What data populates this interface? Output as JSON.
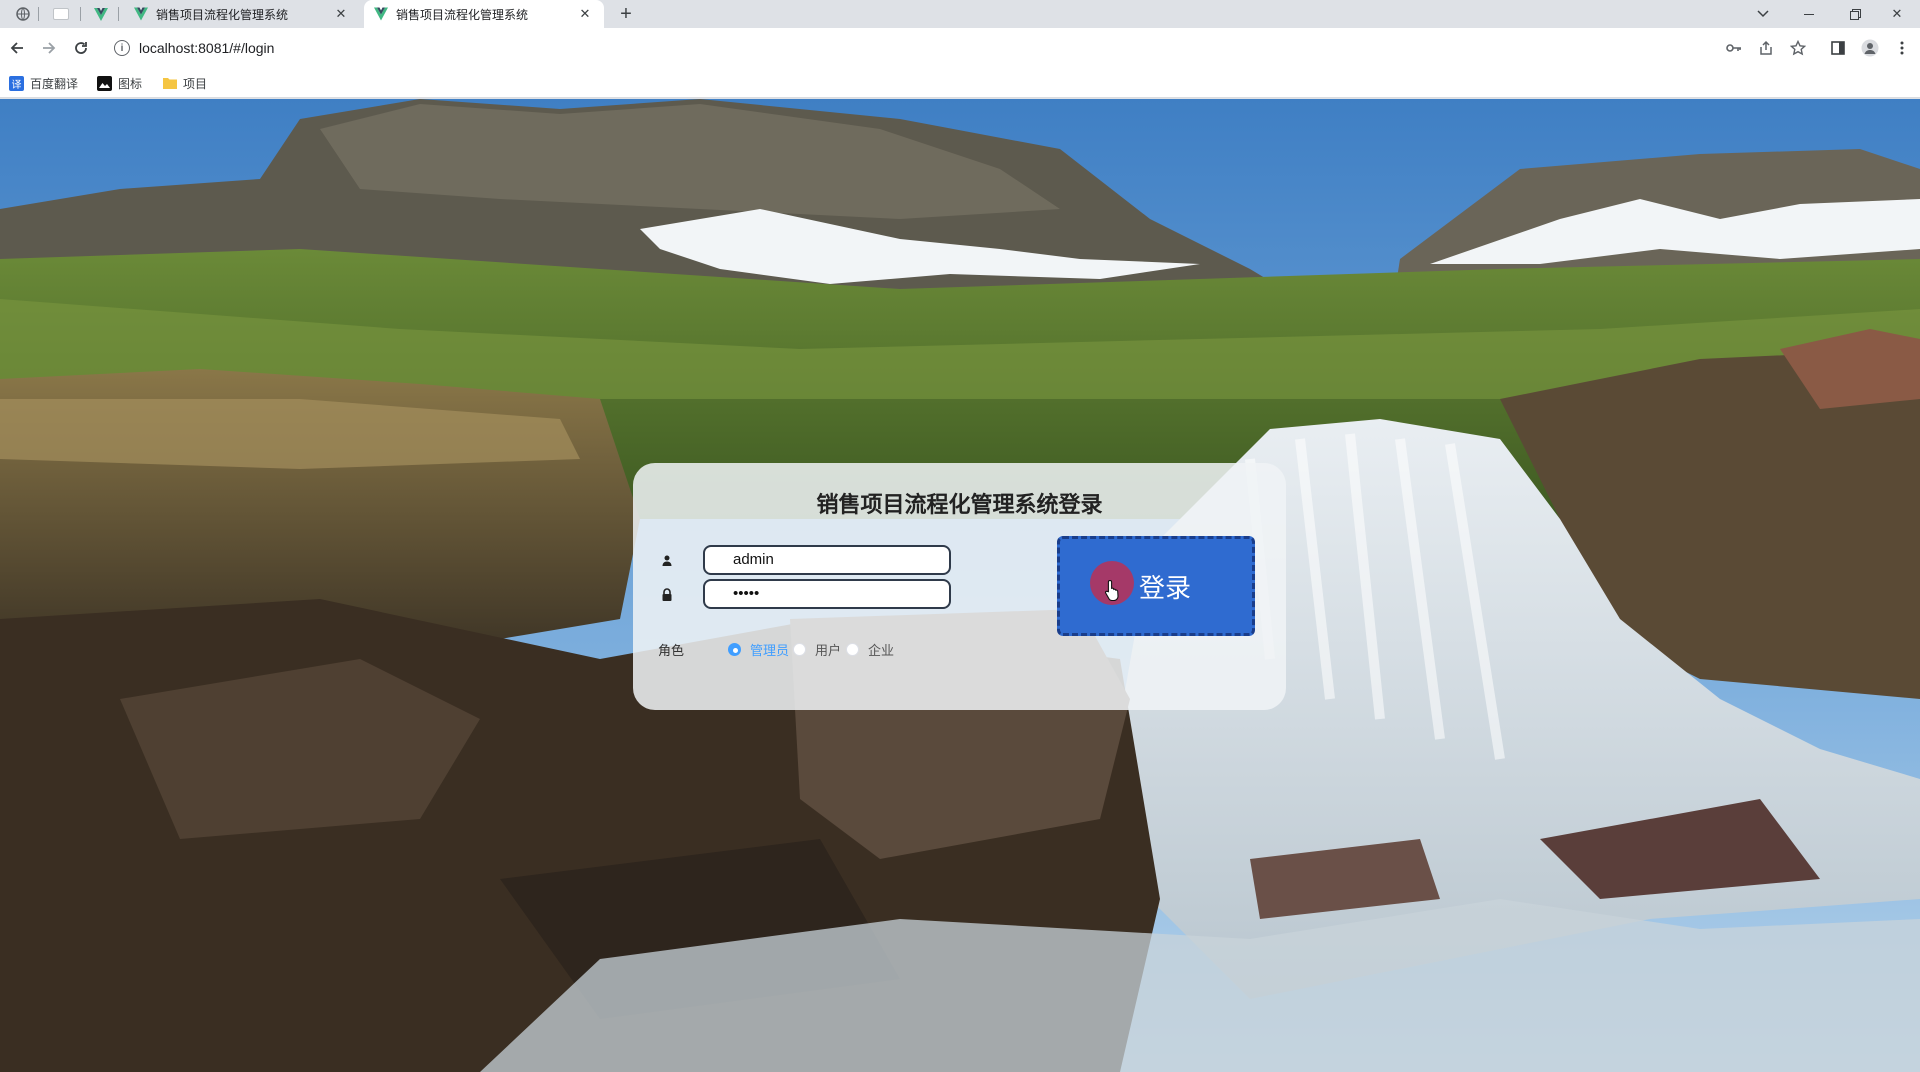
{
  "browser": {
    "tabs": [
      {
        "title": "销售项目流程化管理系统",
        "active": false
      },
      {
        "title": "销售项目流程化管理系统",
        "active": true
      }
    ],
    "new_tab_icon": "plus-icon",
    "address": {
      "url": "localhost:8081/#/login"
    },
    "bookmarks": [
      {
        "label": "百度翻译",
        "icon": "translate-icon"
      },
      {
        "label": "图标",
        "icon": "image-icon"
      },
      {
        "label": "项目",
        "icon": "folder-icon"
      }
    ]
  },
  "login": {
    "title": "销售项目流程化管理系统登录",
    "username": "admin",
    "password": "•••••",
    "role_label": "角色",
    "roles": [
      {
        "label": "管理员",
        "checked": true
      },
      {
        "label": "用户",
        "checked": false
      },
      {
        "label": "企业",
        "checked": false
      }
    ],
    "submit_label": "登录",
    "accent": "#409eff",
    "button_color": "#2f6bd0"
  }
}
